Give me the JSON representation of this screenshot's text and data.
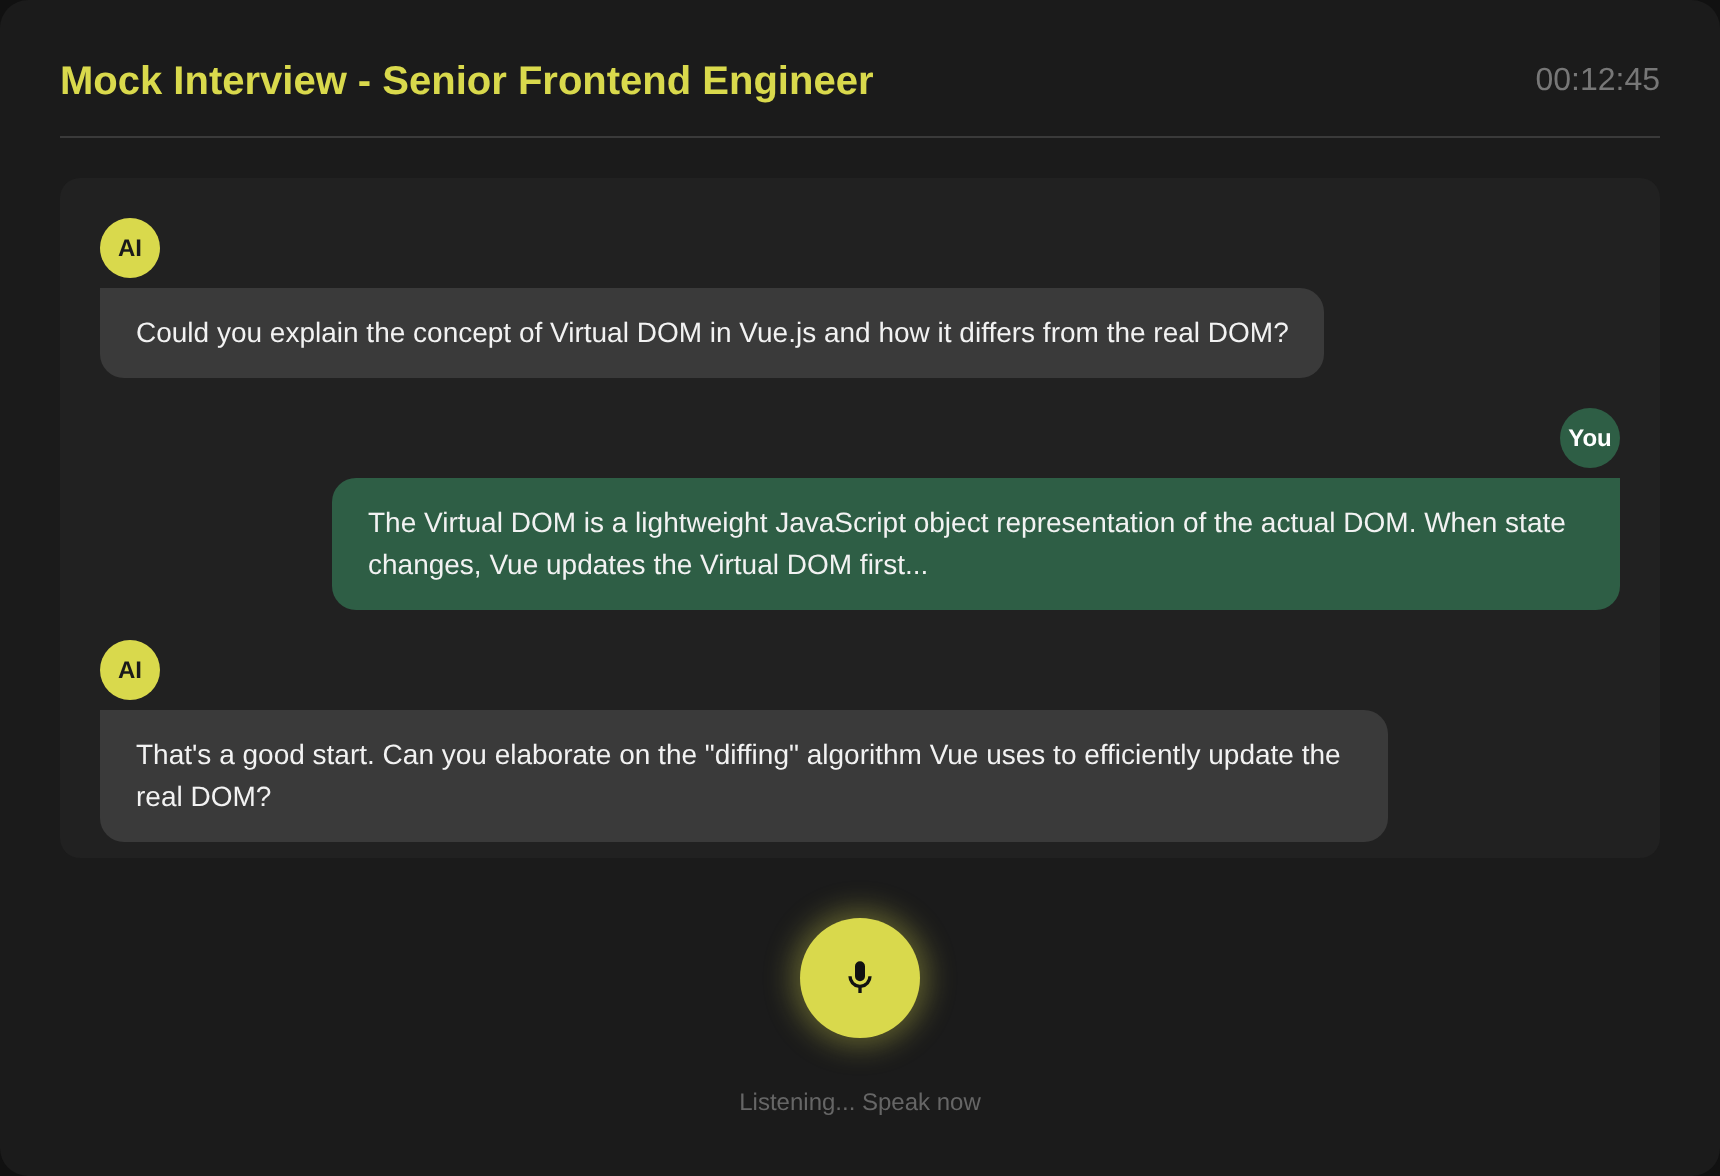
{
  "header": {
    "title": "Mock Interview - Senior Frontend Engineer",
    "timer": "00:12:45"
  },
  "messages": [
    {
      "kind": "ai",
      "avatar": "AI",
      "text": "Could you explain the concept of Virtual DOM in Vue.js and how it differs from the real DOM?"
    },
    {
      "kind": "user",
      "avatar": "You",
      "text": "The Virtual DOM is a lightweight JavaScript object representation of the actual DOM. When state changes, Vue updates the Virtual DOM first..."
    },
    {
      "kind": "ai",
      "avatar": "AI",
      "text": "That's a good start. Can you elaborate on the \"diffing\" algorithm Vue uses to efficiently update the real DOM?"
    }
  ],
  "mic": {
    "active": true,
    "status": "Listening... Speak now"
  }
}
